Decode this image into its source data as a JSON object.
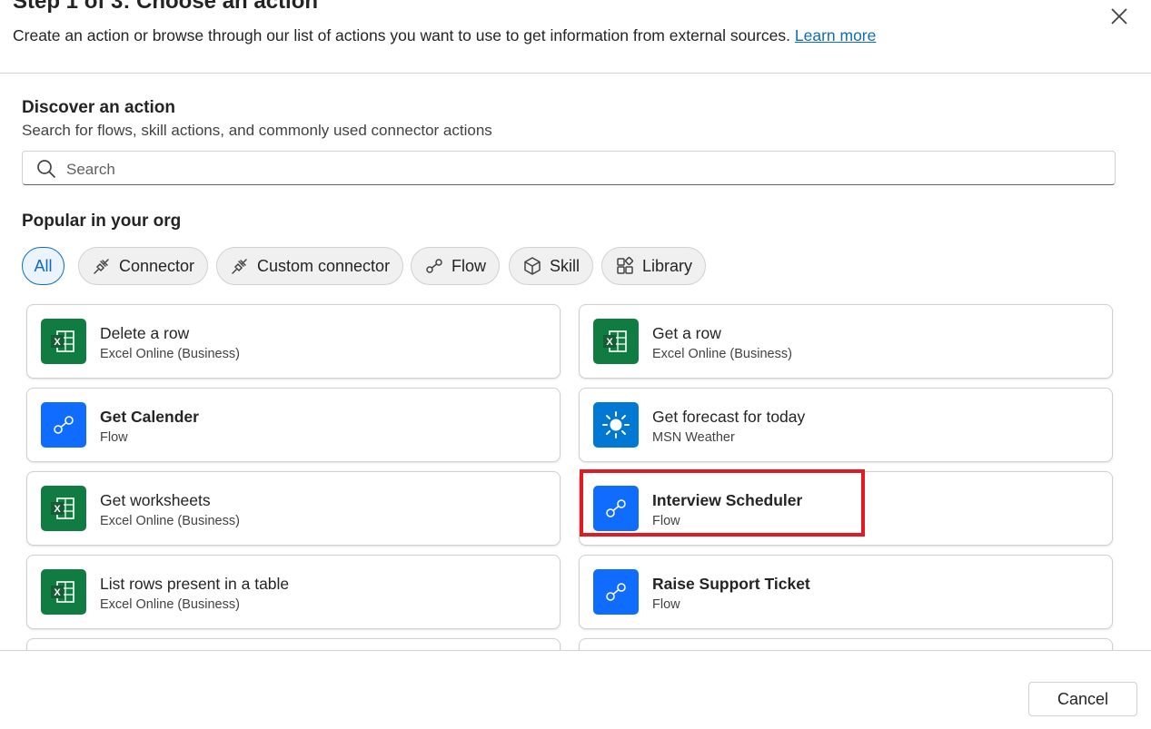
{
  "header": {
    "title": "Step 1 of 3: Choose an action",
    "subtitle": "Create an action or browse through our list of actions you want to use to get information from external sources.",
    "learn_more": "Learn more",
    "close_icon": "close-icon"
  },
  "discover": {
    "title": "Discover an action",
    "subtitle": "Search for flows, skill actions, and commonly used connector actions"
  },
  "search": {
    "placeholder": "Search",
    "value": "",
    "icon": "search-icon"
  },
  "popular": {
    "title": "Popular in your org"
  },
  "filters": [
    {
      "label": "All",
      "icon": "",
      "selected": true
    },
    {
      "label": "Connector",
      "icon": "plug-icon",
      "selected": false
    },
    {
      "label": "Custom connector",
      "icon": "plug-icon",
      "selected": false
    },
    {
      "label": "Flow",
      "icon": "flow-icon",
      "selected": false
    },
    {
      "label": "Skill",
      "icon": "cube-icon",
      "selected": false
    },
    {
      "label": "Library",
      "icon": "apps-add-icon",
      "selected": false
    }
  ],
  "actions": [
    {
      "name": "Delete a row",
      "source": "Excel Online (Business)",
      "icon": "excel-icon",
      "bold": false
    },
    {
      "name": "Get a row",
      "source": "Excel Online (Business)",
      "icon": "excel-icon",
      "bold": false
    },
    {
      "name": "Get Calender",
      "source": "Flow",
      "icon": "flow-icon",
      "bold": true
    },
    {
      "name": "Get forecast for today",
      "source": "MSN Weather",
      "icon": "weather-icon",
      "bold": false
    },
    {
      "name": "Get worksheets",
      "source": "Excel Online (Business)",
      "icon": "excel-icon",
      "bold": false
    },
    {
      "name": "Interview Scheduler",
      "source": "Flow",
      "icon": "flow-icon",
      "bold": true,
      "highlighted": true
    },
    {
      "name": "List rows present in a table",
      "source": "Excel Online (Business)",
      "icon": "excel-icon",
      "bold": false
    },
    {
      "name": "Raise Support Ticket",
      "source": "Flow",
      "icon": "flow-icon",
      "bold": true
    }
  ],
  "footer": {
    "cancel_label": "Cancel"
  },
  "colors": {
    "excel": "#107c41",
    "flow": "#0f6cff",
    "weather": "#0078d4",
    "accent": "#0f6cbd",
    "highlight": "#e01b24"
  }
}
